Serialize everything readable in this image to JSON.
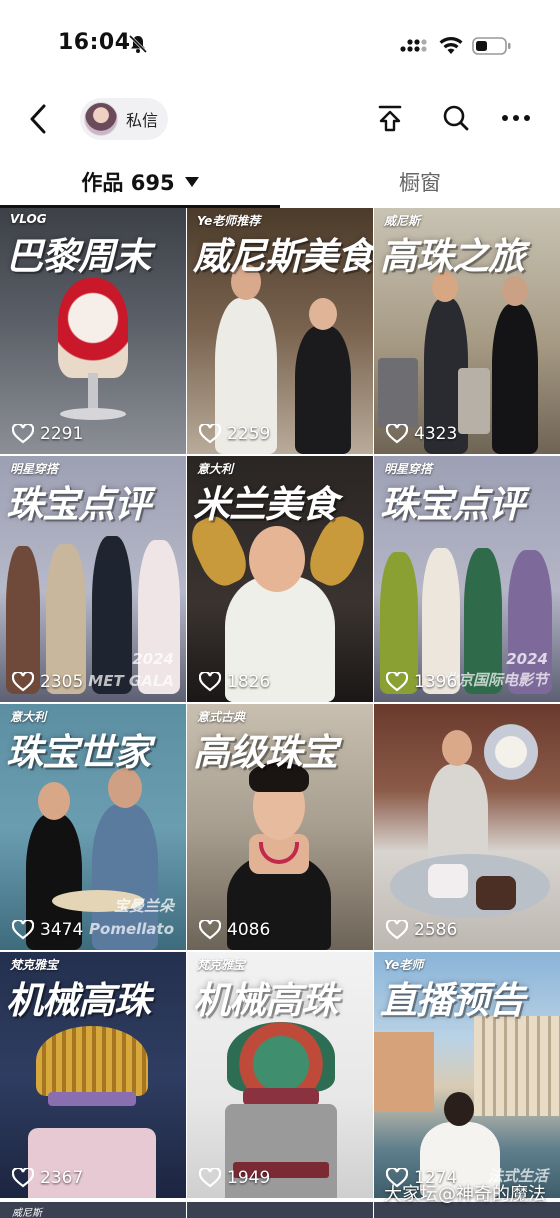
{
  "status_bar": {
    "time": "16:04"
  },
  "header": {
    "dm_label": "私信"
  },
  "tabs": {
    "works_label": "作品 695",
    "shop_label": "橱窗"
  },
  "grid": [
    {
      "tag": "VLOG",
      "headline": "巴黎周末",
      "likes": "2291",
      "sub": "",
      "sub2": ""
    },
    {
      "tag": "Ye老师推荐",
      "headline": "威尼斯美食",
      "likes": "2259",
      "sub": "",
      "sub2": ""
    },
    {
      "tag": "威尼斯",
      "headline": "高珠之旅",
      "likes": "4323",
      "sub": "",
      "sub2": ""
    },
    {
      "tag": "明星穿搭",
      "headline": "珠宝点评",
      "likes": "2305",
      "sub": "2024",
      "sub2": "MET GALA"
    },
    {
      "tag": "意大利",
      "headline": "米兰美食",
      "likes": "1826",
      "sub": "",
      "sub2": ""
    },
    {
      "tag": "明星穿搭",
      "headline": "珠宝点评",
      "likes": "1396",
      "sub": "2024",
      "sub2": "北京国际电影节"
    },
    {
      "tag": "意大利",
      "headline": "珠宝世家",
      "likes": "3474",
      "sub": "宝曼兰朵",
      "sub2": "Pomellato"
    },
    {
      "tag": "意式古典",
      "headline": "高级珠宝",
      "likes": "4086",
      "sub": "",
      "sub2": ""
    },
    {
      "tag": "",
      "headline": "",
      "likes": "2586",
      "sub": "",
      "sub2": ""
    },
    {
      "tag": "梵克雅宝",
      "headline": "机械高珠",
      "likes": "2367",
      "sub": "",
      "sub2": ""
    },
    {
      "tag": "梵克雅宝",
      "headline": "机械高珠",
      "likes": "1949",
      "sub": "",
      "sub2": ""
    },
    {
      "tag": "Ye老师",
      "headline": "直播预告",
      "likes": "1274",
      "sub": "",
      "sub2": "法式生活"
    }
  ],
  "peek_tag": "威尼斯",
  "watermark": "大家坛@神奇的魔法",
  "icons": [
    "bell-mute-icon",
    "signal-icon",
    "wifi-icon",
    "battery-icon",
    "back-arrow-icon",
    "share-icon",
    "search-icon",
    "more-icon",
    "heart-icon",
    "caret-down-icon"
  ]
}
